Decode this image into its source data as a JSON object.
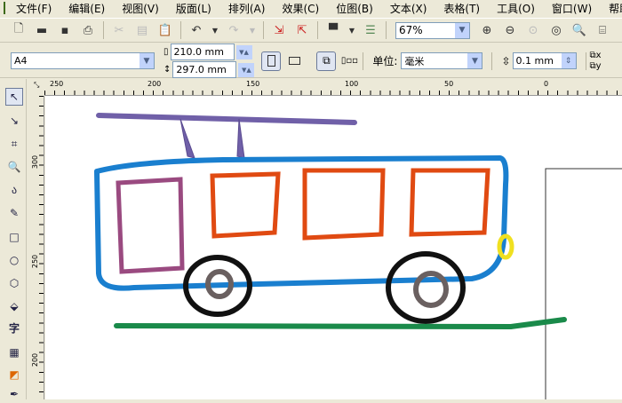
{
  "menu": [
    "文件(F)",
    "编辑(E)",
    "视图(V)",
    "版面(L)",
    "排列(A)",
    "效果(C)",
    "位图(B)",
    "文本(X)",
    "表格(T)",
    "工具(O)",
    "窗口(W)",
    "帮助(H)"
  ],
  "toolbar": {
    "zoom": "67%"
  },
  "propbar": {
    "paper": "A4",
    "width": "210.0 mm",
    "height": "297.0 mm",
    "unit_label": "单位:",
    "unit": "毫米",
    "nudge": "0.1 mm"
  },
  "hruler": [
    "250",
    "200",
    "150",
    "100",
    "50",
    "0"
  ],
  "vruler": [
    "300",
    "250",
    "200"
  ],
  "toolbox": {
    "text_tool": "字"
  },
  "colors": {
    "bus_body": "#1a7fcf",
    "window_red": "#e04a12",
    "window_purple": "#9a4a80",
    "pole": "#7060a8",
    "road": "#1a8a4a",
    "wheel": "#111111",
    "hub": "#6a6060",
    "light": "#f0e020"
  }
}
